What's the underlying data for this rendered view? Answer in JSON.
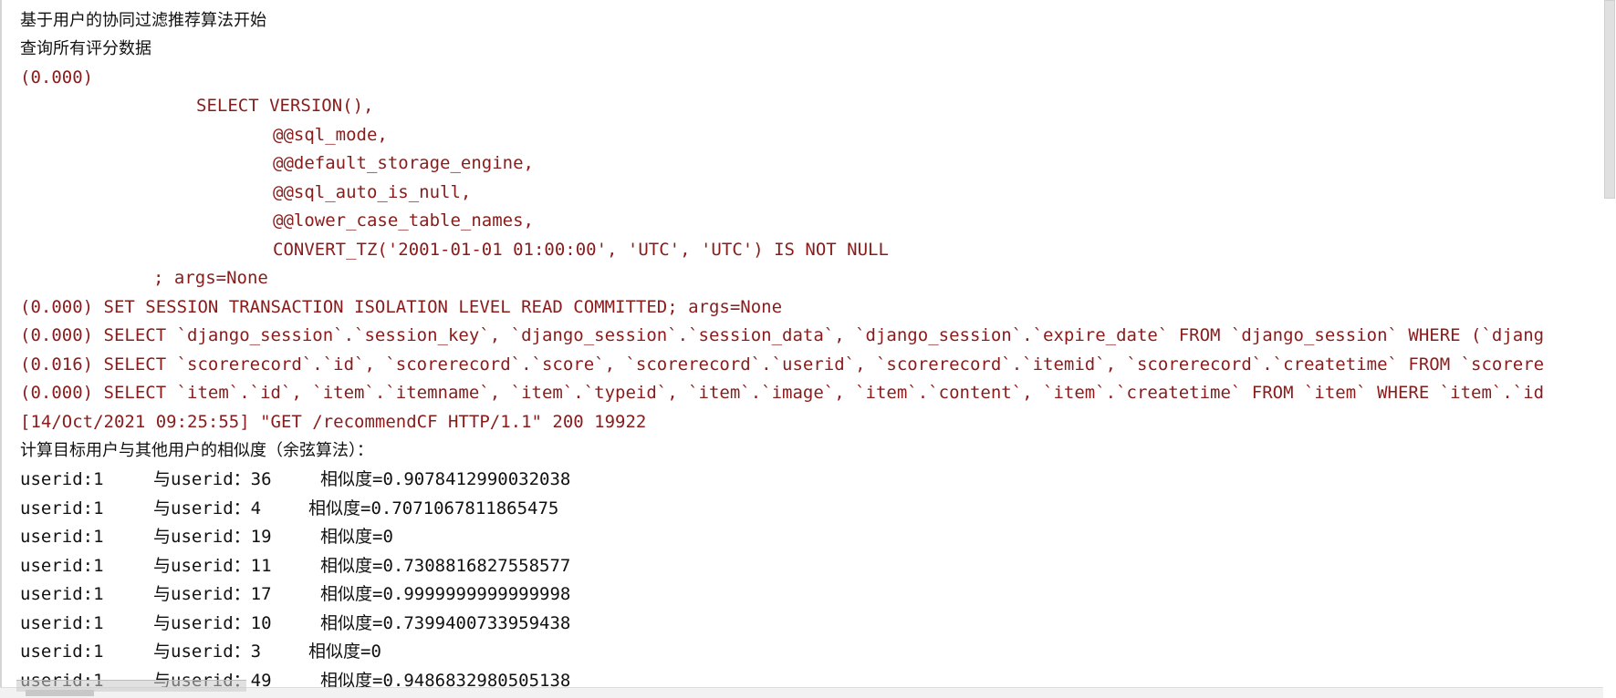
{
  "console": {
    "intro": [
      "基于用户的协同过滤推荐算法开始",
      "查询所有评分数据"
    ],
    "sql_block": [
      "(0.000)",
      "SELECT VERSION(),",
      "@@sql_mode,",
      "@@default_storage_engine,",
      "@@sql_auto_is_null,",
      "@@lower_case_table_names,",
      "CONVERT_TZ('2001-01-01 01:00:00', 'UTC', 'UTC') IS NOT NULL",
      "; args=None",
      "(0.000) SET SESSION TRANSACTION ISOLATION LEVEL READ COMMITTED; args=None",
      "(0.000) SELECT `django_session`.`session_key`, `django_session`.`session_data`, `django_session`.`expire_date` FROM `django_session` WHERE (`djang",
      "(0.016) SELECT `scorerecord`.`id`, `scorerecord`.`score`, `scorerecord`.`userid`, `scorerecord`.`itemid`, `scorerecord`.`createtime` FROM `scorere",
      "(0.000) SELECT `item`.`id`, `item`.`itemname`, `item`.`typeid`, `item`.`image`, `item`.`content`, `item`.`createtime` FROM `item` WHERE `item`.`id",
      "[14/Oct/2021 09:25:55] \"GET /recommendCF HTTP/1.1\" 200 19922"
    ],
    "similarity_heading": "计算目标用户与其他用户的相似度（余弦算法）：",
    "similarity_rows": [
      {
        "user": "userid:1",
        "other": "与userid：36",
        "sim": "相似度=0.9078412990032038"
      },
      {
        "user": "userid:1",
        "other": "与userid：4",
        "sim": "相似度=0.7071067811865475"
      },
      {
        "user": "userid:1",
        "other": "与userid：19",
        "sim": "相似度=0"
      },
      {
        "user": "userid:1",
        "other": "与userid：11",
        "sim": "相似度=0.7308816827558577"
      },
      {
        "user": "userid:1",
        "other": "与userid：17",
        "sim": "相似度=0.9999999999999998"
      },
      {
        "user": "userid:1",
        "other": "与userid：10",
        "sim": "相似度=0.7399400733959438"
      },
      {
        "user": "userid:1",
        "other": "与userid：3",
        "sim": "相似度=0"
      },
      {
        "user": "userid:1",
        "other": "与userid：49",
        "sim": "相似度=0.9486832980505138"
      }
    ]
  },
  "colors": {
    "sql_text": "#8a1b1b",
    "plain_text": "#111111"
  }
}
